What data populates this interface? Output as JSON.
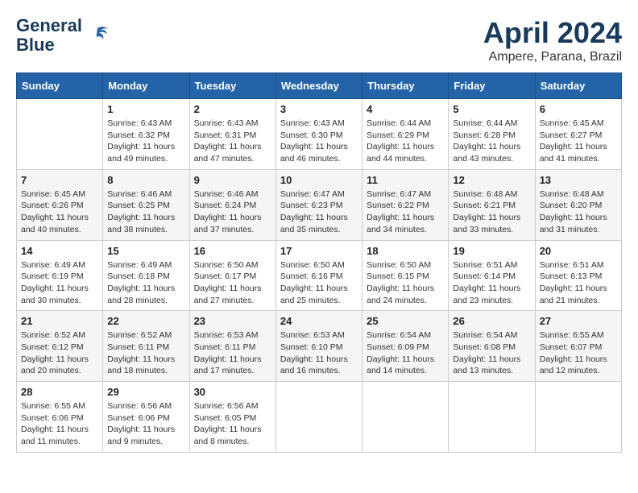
{
  "header": {
    "logo_line1": "General",
    "logo_line2": "Blue",
    "month": "April 2024",
    "location": "Ampere, Parana, Brazil"
  },
  "weekdays": [
    "Sunday",
    "Monday",
    "Tuesday",
    "Wednesday",
    "Thursday",
    "Friday",
    "Saturday"
  ],
  "weeks": [
    [
      {
        "day": "",
        "info": ""
      },
      {
        "day": "1",
        "info": "Sunrise: 6:43 AM\nSunset: 6:32 PM\nDaylight: 11 hours\nand 49 minutes."
      },
      {
        "day": "2",
        "info": "Sunrise: 6:43 AM\nSunset: 6:31 PM\nDaylight: 11 hours\nand 47 minutes."
      },
      {
        "day": "3",
        "info": "Sunrise: 6:43 AM\nSunset: 6:30 PM\nDaylight: 11 hours\nand 46 minutes."
      },
      {
        "day": "4",
        "info": "Sunrise: 6:44 AM\nSunset: 6:29 PM\nDaylight: 11 hours\nand 44 minutes."
      },
      {
        "day": "5",
        "info": "Sunrise: 6:44 AM\nSunset: 6:28 PM\nDaylight: 11 hours\nand 43 minutes."
      },
      {
        "day": "6",
        "info": "Sunrise: 6:45 AM\nSunset: 6:27 PM\nDaylight: 11 hours\nand 41 minutes."
      }
    ],
    [
      {
        "day": "7",
        "info": "Sunrise: 6:45 AM\nSunset: 6:26 PM\nDaylight: 11 hours\nand 40 minutes."
      },
      {
        "day": "8",
        "info": "Sunrise: 6:46 AM\nSunset: 6:25 PM\nDaylight: 11 hours\nand 38 minutes."
      },
      {
        "day": "9",
        "info": "Sunrise: 6:46 AM\nSunset: 6:24 PM\nDaylight: 11 hours\nand 37 minutes."
      },
      {
        "day": "10",
        "info": "Sunrise: 6:47 AM\nSunset: 6:23 PM\nDaylight: 11 hours\nand 35 minutes."
      },
      {
        "day": "11",
        "info": "Sunrise: 6:47 AM\nSunset: 6:22 PM\nDaylight: 11 hours\nand 34 minutes."
      },
      {
        "day": "12",
        "info": "Sunrise: 6:48 AM\nSunset: 6:21 PM\nDaylight: 11 hours\nand 33 minutes."
      },
      {
        "day": "13",
        "info": "Sunrise: 6:48 AM\nSunset: 6:20 PM\nDaylight: 11 hours\nand 31 minutes."
      }
    ],
    [
      {
        "day": "14",
        "info": "Sunrise: 6:49 AM\nSunset: 6:19 PM\nDaylight: 11 hours\nand 30 minutes."
      },
      {
        "day": "15",
        "info": "Sunrise: 6:49 AM\nSunset: 6:18 PM\nDaylight: 11 hours\nand 28 minutes."
      },
      {
        "day": "16",
        "info": "Sunrise: 6:50 AM\nSunset: 6:17 PM\nDaylight: 11 hours\nand 27 minutes."
      },
      {
        "day": "17",
        "info": "Sunrise: 6:50 AM\nSunset: 6:16 PM\nDaylight: 11 hours\nand 25 minutes."
      },
      {
        "day": "18",
        "info": "Sunrise: 6:50 AM\nSunset: 6:15 PM\nDaylight: 11 hours\nand 24 minutes."
      },
      {
        "day": "19",
        "info": "Sunrise: 6:51 AM\nSunset: 6:14 PM\nDaylight: 11 hours\nand 23 minutes."
      },
      {
        "day": "20",
        "info": "Sunrise: 6:51 AM\nSunset: 6:13 PM\nDaylight: 11 hours\nand 21 minutes."
      }
    ],
    [
      {
        "day": "21",
        "info": "Sunrise: 6:52 AM\nSunset: 6:12 PM\nDaylight: 11 hours\nand 20 minutes."
      },
      {
        "day": "22",
        "info": "Sunrise: 6:52 AM\nSunset: 6:11 PM\nDaylight: 11 hours\nand 18 minutes."
      },
      {
        "day": "23",
        "info": "Sunrise: 6:53 AM\nSunset: 6:11 PM\nDaylight: 11 hours\nand 17 minutes."
      },
      {
        "day": "24",
        "info": "Sunrise: 6:53 AM\nSunset: 6:10 PM\nDaylight: 11 hours\nand 16 minutes."
      },
      {
        "day": "25",
        "info": "Sunrise: 6:54 AM\nSunset: 6:09 PM\nDaylight: 11 hours\nand 14 minutes."
      },
      {
        "day": "26",
        "info": "Sunrise: 6:54 AM\nSunset: 6:08 PM\nDaylight: 11 hours\nand 13 minutes."
      },
      {
        "day": "27",
        "info": "Sunrise: 6:55 AM\nSunset: 6:07 PM\nDaylight: 11 hours\nand 12 minutes."
      }
    ],
    [
      {
        "day": "28",
        "info": "Sunrise: 6:55 AM\nSunset: 6:06 PM\nDaylight: 11 hours\nand 11 minutes."
      },
      {
        "day": "29",
        "info": "Sunrise: 6:56 AM\nSunset: 6:06 PM\nDaylight: 11 hours\nand 9 minutes."
      },
      {
        "day": "30",
        "info": "Sunrise: 6:56 AM\nSunset: 6:05 PM\nDaylight: 11 hours\nand 8 minutes."
      },
      {
        "day": "",
        "info": ""
      },
      {
        "day": "",
        "info": ""
      },
      {
        "day": "",
        "info": ""
      },
      {
        "day": "",
        "info": ""
      }
    ]
  ]
}
